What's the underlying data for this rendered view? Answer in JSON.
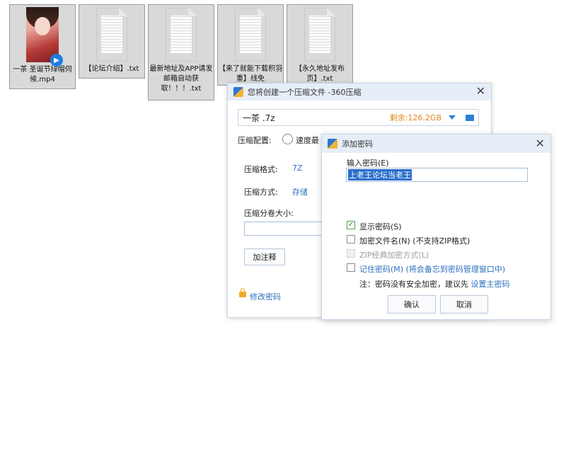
{
  "desktop": {
    "files": [
      {
        "name": "一茶 圣诞节绿帽伺候.mp4",
        "type": "video"
      },
      {
        "name": "【论坛介绍】.txt",
        "type": "text"
      },
      {
        "name": "最新地址及APP请发邮箱自动获取！！！.txt",
        "type": "text"
      },
      {
        "name": "【来了就能下载积羽重】线免",
        "type": "text"
      },
      {
        "name": "【永久地址发布页】.txt",
        "type": "text"
      }
    ]
  },
  "compress_window": {
    "title": "您将创建一个压缩文件 -360压缩",
    "filename": "一茶 .7z",
    "free_space": "剩余:126.2GB",
    "config_label": "压缩配置:",
    "speed_label": "速度最",
    "format_label": "压缩格式:",
    "format_value": "7Z",
    "method_label": "压缩方式:",
    "method_value": "存储",
    "volume_label": "压缩分卷大小:",
    "comment_button": "加注释",
    "change_password": "修改密码"
  },
  "password_dialog": {
    "title": "添加密码",
    "input_label": "输入密码(E)",
    "password": "上老王论坛当老王",
    "show_password": "显示密码(S)",
    "show_password_checked": true,
    "encrypt_filenames": "加密文件名(N) (不支持ZIP格式)",
    "zip_classic": "ZIP经典加密方式(L)",
    "remember_password": "记住密码(M) (将会备忘到密码管理窗口中)",
    "note_prefix": "注：密码没有安全加密，建议先",
    "note_link": "设置主密码",
    "ok_button": "确认",
    "cancel_button": "取消"
  }
}
